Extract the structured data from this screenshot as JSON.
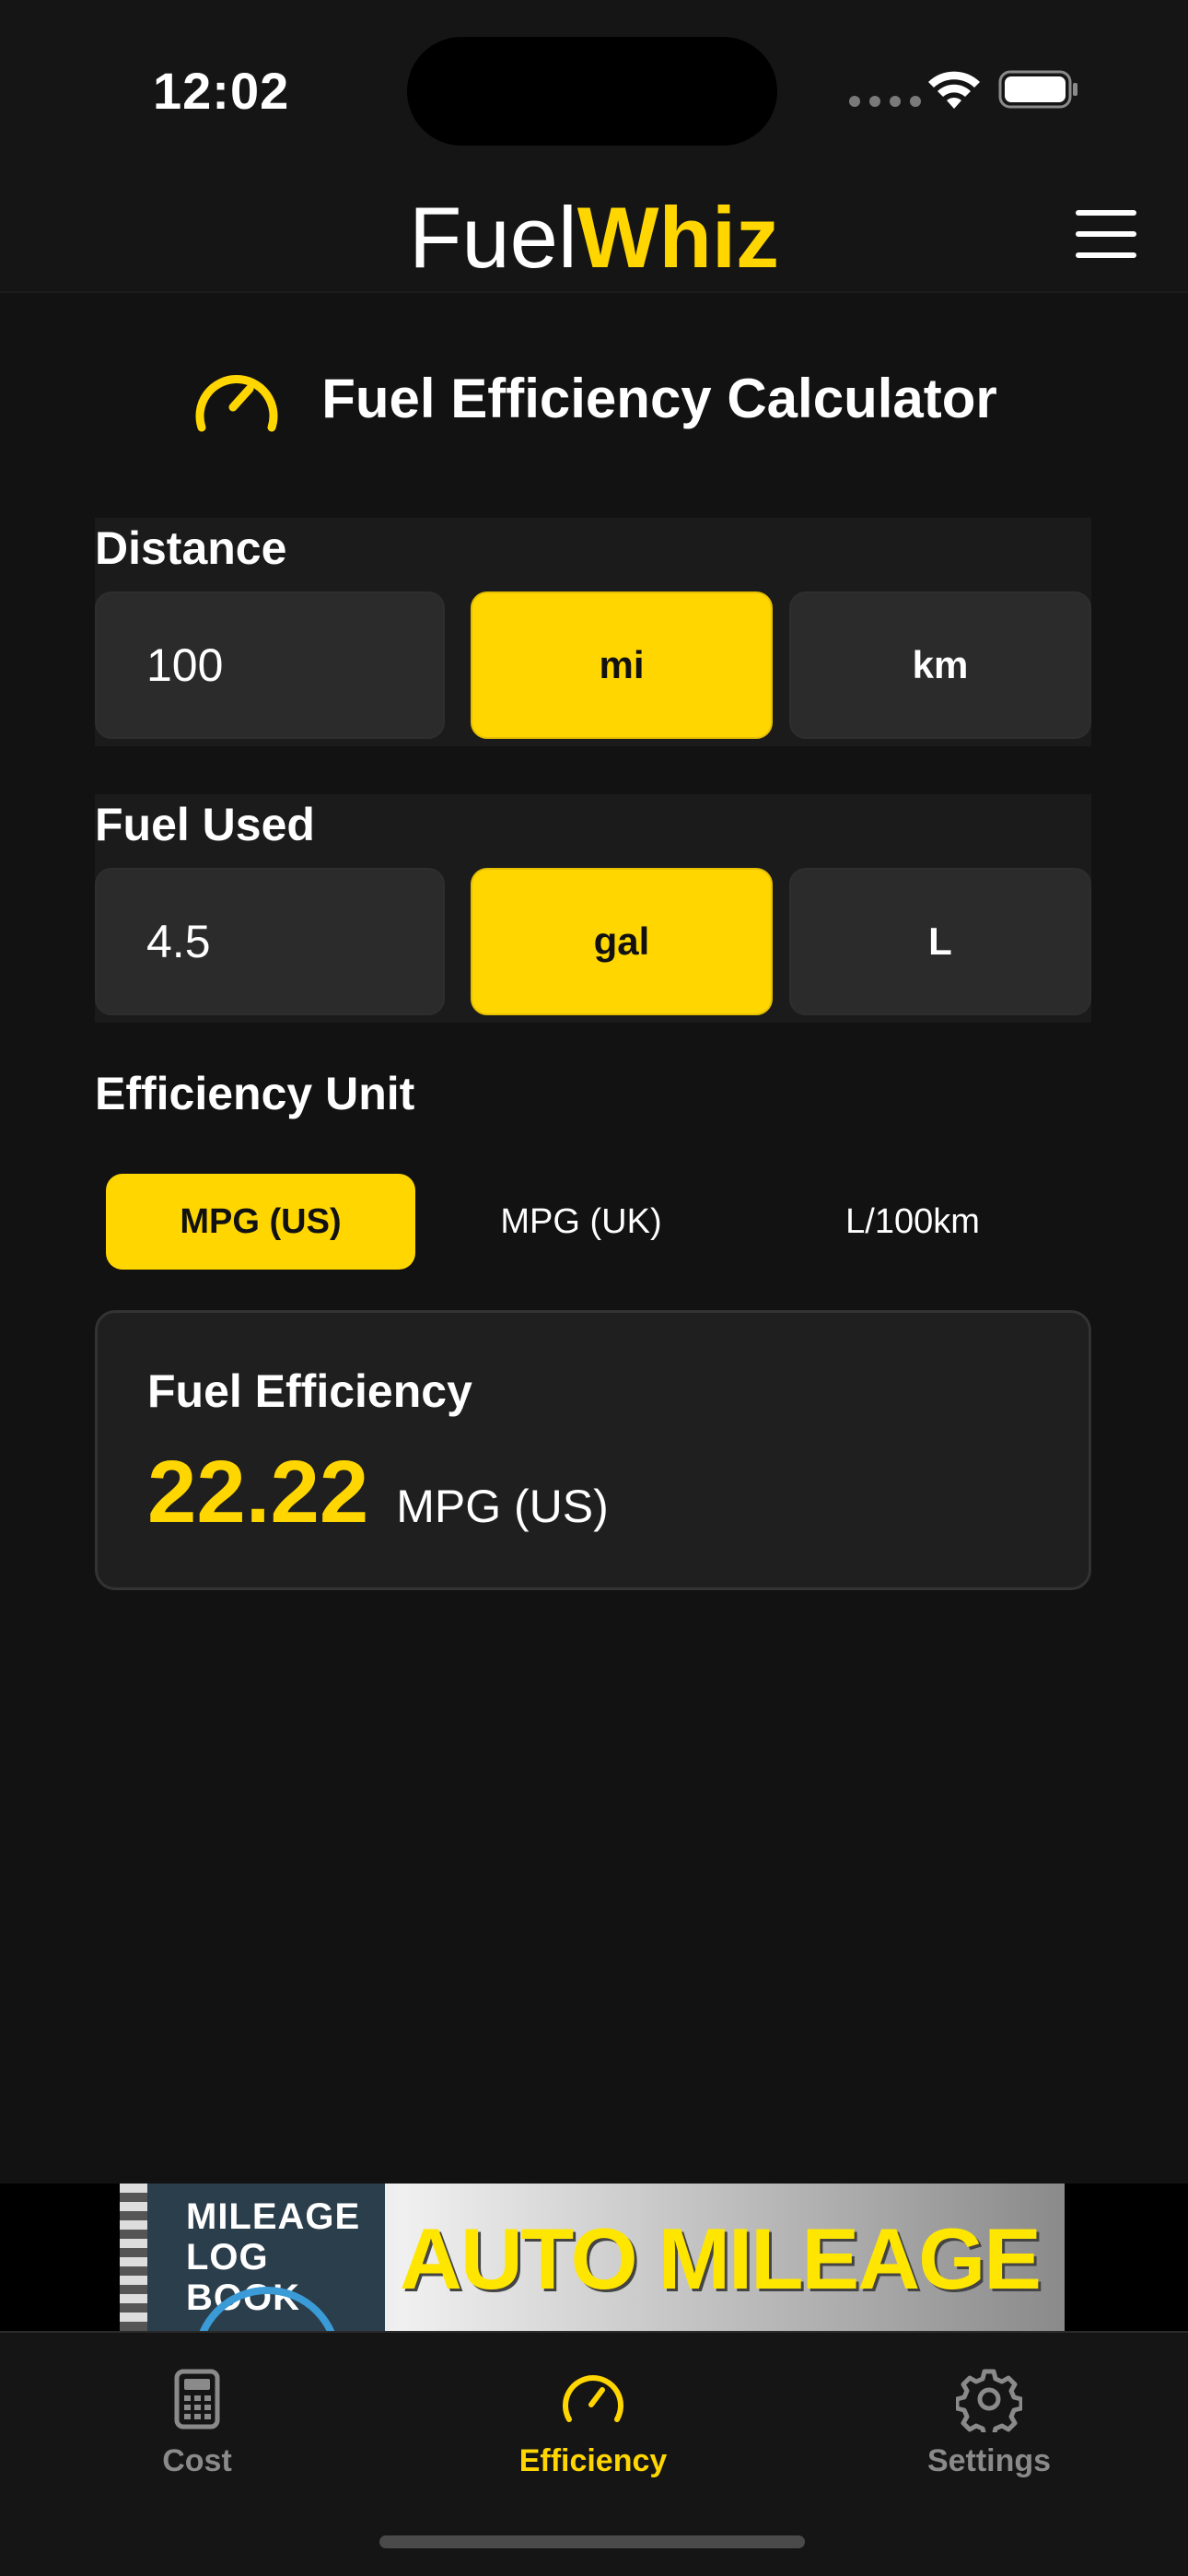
{
  "status_bar": {
    "time": "12:02"
  },
  "header": {
    "logo_part1": "Fuel",
    "logo_part2": "Whiz"
  },
  "page": {
    "title": "Fuel Efficiency Calculator"
  },
  "distance": {
    "label": "Distance",
    "value": "100",
    "units": [
      {
        "label": "mi",
        "selected": true
      },
      {
        "label": "km",
        "selected": false
      }
    ]
  },
  "fuel": {
    "label": "Fuel Used",
    "value": "4.5",
    "units": [
      {
        "label": "gal",
        "selected": true
      },
      {
        "label": "L",
        "selected": false
      }
    ]
  },
  "efficiency_unit": {
    "label": "Efficiency Unit",
    "options": [
      {
        "label": "MPG (US)",
        "selected": true
      },
      {
        "label": "MPG (UK)",
        "selected": false
      },
      {
        "label": "L/100km",
        "selected": false
      }
    ]
  },
  "result": {
    "label": "Fuel Efficiency",
    "value": "22.22",
    "unit": "MPG (US)"
  },
  "ad": {
    "logbook_line1": "MILEAGE",
    "logbook_line2": "LOG BOOK",
    "headline": "AUTO MILEAGE"
  },
  "tabs": [
    {
      "label": "Cost",
      "icon": "calculator-icon",
      "active": false
    },
    {
      "label": "Efficiency",
      "icon": "speedometer-icon",
      "active": true
    },
    {
      "label": "Settings",
      "icon": "gear-icon",
      "active": false
    }
  ],
  "colors": {
    "accent": "#FFD600",
    "background": "#121212",
    "surface": "#2b2b2b"
  }
}
